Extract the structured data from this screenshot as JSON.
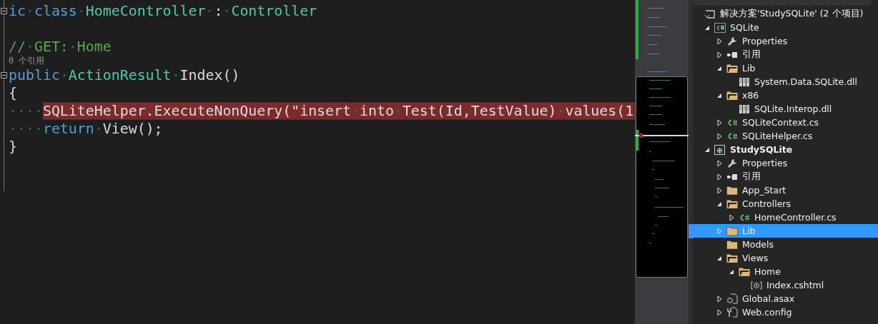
{
  "editor": {
    "lines": [
      {
        "kind": "code",
        "highlighted": false,
        "fold": true,
        "indented": false,
        "tokens": [
          {
            "kind": "keyword",
            "text": "ic"
          },
          {
            "kind": "keyword",
            "text": "class"
          },
          {
            "kind": "type",
            "text": "HomeController"
          },
          {
            "kind": "plain",
            "text": ":"
          },
          {
            "kind": "type",
            "text": "Controller"
          }
        ]
      },
      {
        "kind": "code",
        "highlighted": false,
        "fold": false,
        "indented": false
      },
      {
        "kind": "code",
        "highlighted": false,
        "fold": false,
        "indented": false,
        "tokens": [
          {
            "kind": "comment",
            "text": "//"
          },
          {
            "kind": "comment",
            "text": "GET:"
          },
          {
            "kind": "comment",
            "text": "Home"
          }
        ]
      },
      {
        "kind": "codelens",
        "text": "0 个引用"
      },
      {
        "kind": "code",
        "highlighted": false,
        "fold": true,
        "indented": false,
        "tokens": [
          {
            "kind": "keyword",
            "text": "public"
          },
          {
            "kind": "type",
            "text": "ActionResult"
          },
          {
            "kind": "plain",
            "text": "Index()"
          }
        ]
      },
      {
        "kind": "code",
        "highlighted": false,
        "fold": false,
        "indented": false,
        "tokens": [
          {
            "kind": "plain",
            "text": "{"
          }
        ]
      },
      {
        "kind": "code",
        "highlighted": true,
        "fold": false,
        "indented": true,
        "tokens": [
          {
            "kind": "plain",
            "text": "SQLiteHelper.ExecuteNonQuery(\"insert"
          },
          {
            "kind": "plain",
            "text": "into"
          },
          {
            "kind": "plain",
            "text": "Test(Id,TestValue)"
          },
          {
            "kind": "plain",
            "text": "values(1"
          }
        ]
      },
      {
        "kind": "code",
        "highlighted": false,
        "fold": false,
        "indented": true,
        "tokens": [
          {
            "kind": "keyword",
            "text": "return"
          },
          {
            "kind": "plain",
            "text": "View();"
          }
        ]
      },
      {
        "kind": "code",
        "highlighted": false,
        "fold": false,
        "indented": false,
        "tokens": [
          {
            "kind": "plain",
            "text": "}"
          }
        ]
      }
    ]
  },
  "solution_explorer": {
    "tree": [
      {
        "label": "解决方案'StudySQLite' (2 个项目)",
        "kind": "solution",
        "selected": false,
        "bold": false,
        "children": [
          {
            "label": "SQLite",
            "kind": "csproj",
            "expanded": true,
            "selected": false,
            "bold": false,
            "children": [
              {
                "label": "Properties",
                "kind": "wrench",
                "expanded": false,
                "selected": false,
                "bold": false
              },
              {
                "label": "引用",
                "kind": "reference",
                "expanded": false,
                "selected": false,
                "bold": false
              },
              {
                "label": "Lib",
                "kind": "folder",
                "expanded": true,
                "selected": false,
                "bold": false,
                "children": [
                  {
                    "label": "System.Data.SQLite.dll",
                    "kind": "dll",
                    "selected": false,
                    "bold": false
                  }
                ]
              },
              {
                "label": "x86",
                "kind": "folder",
                "expanded": true,
                "selected": false,
                "bold": false,
                "children": [
                  {
                    "label": "SQLite.Interop.dll",
                    "kind": "dll",
                    "selected": false,
                    "bold": false
                  }
                ]
              },
              {
                "label": "SQLiteContext.cs",
                "kind": "cs",
                "expanded": false,
                "selected": false,
                "bold": false
              },
              {
                "label": "SQLiteHelper.cs",
                "kind": "cs",
                "expanded": false,
                "selected": false,
                "bold": false
              }
            ]
          },
          {
            "label": "StudySQLite",
            "kind": "webproj",
            "expanded": true,
            "selected": false,
            "bold": true,
            "children": [
              {
                "label": "Properties",
                "kind": "wrench",
                "expanded": false,
                "selected": false,
                "bold": false
              },
              {
                "label": "引用",
                "kind": "reference",
                "expanded": false,
                "selected": false,
                "bold": false
              },
              {
                "label": "App_Start",
                "kind": "folder",
                "expanded": false,
                "selected": false,
                "bold": false
              },
              {
                "label": "Controllers",
                "kind": "folder",
                "expanded": true,
                "selected": false,
                "bold": false,
                "children": [
                  {
                    "label": "HomeController.cs",
                    "kind": "cs",
                    "expanded": false,
                    "selected": false,
                    "bold": false
                  }
                ]
              },
              {
                "label": "Lib",
                "kind": "folder",
                "expanded": false,
                "selected": true,
                "bold": false
              },
              {
                "label": "Models",
                "kind": "folder",
                "selected": false,
                "bold": false
              },
              {
                "label": "Views",
                "kind": "folder",
                "expanded": true,
                "selected": false,
                "bold": false,
                "children": [
                  {
                    "label": "Home",
                    "kind": "folder",
                    "expanded": true,
                    "selected": false,
                    "bold": false,
                    "children": [
                      {
                        "label": "Index.cshtml",
                        "kind": "cshtml",
                        "selected": false,
                        "bold": false
                      }
                    ]
                  }
                ]
              },
              {
                "label": "Global.asax",
                "kind": "asax",
                "expanded": false,
                "selected": false,
                "bold": false
              },
              {
                "label": "Web.config",
                "kind": "config",
                "expanded": false,
                "selected": false,
                "bold": false
              }
            ]
          }
        ]
      }
    ]
  }
}
